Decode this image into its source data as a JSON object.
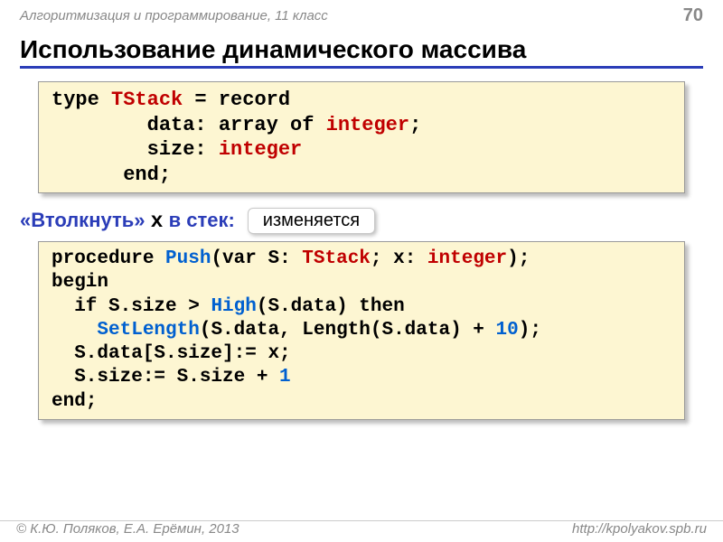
{
  "header": {
    "course": "Алгоритмизация и программирование, 11 класс",
    "page": "70"
  },
  "title": "Использование динамического массива",
  "code1": {
    "l1a": "type ",
    "l1b": "TStack",
    "l1c": " = record",
    "l2a": "        data: array of ",
    "l2b": "integer",
    "l2c": ";",
    "l3a": "        size: ",
    "l3b": "integer",
    "l4": "      end;"
  },
  "subhead": {
    "part1": "«Втолкнуть» ",
    "var": "x",
    "part2": " в стек:",
    "badge": "изменяется"
  },
  "code2": {
    "l1a": "procedure ",
    "l1b": "Push",
    "l1c": "(var S: ",
    "l1d": "TStack",
    "l1e": "; x: ",
    "l1f": "integer",
    "l1g": ");",
    "l2": "begin",
    "l3a": "  if S.size > ",
    "l3b": "High",
    "l3c": "(S.data) then",
    "l4a": "    ",
    "l4b": "SetLength",
    "l4c": "(S.data, Length(S.data) + ",
    "l4d": "10",
    "l4e": ");",
    "l5": "  S.data[S.size]:= x;",
    "l6a": "  S.size:= S.size + ",
    "l6b": "1",
    "l7": "end;"
  },
  "footer": {
    "left": "К.Ю. Поляков, Е.А. Ерёмин, 2013",
    "right": "http://kpolyakov.spb.ru"
  }
}
